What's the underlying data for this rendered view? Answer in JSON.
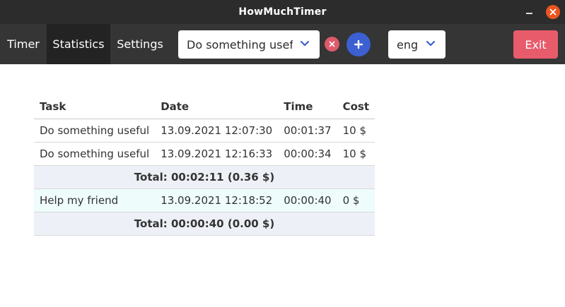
{
  "window": {
    "title": "HowMuchTimer"
  },
  "nav": {
    "timer": "Timer",
    "statistics": "Statistics",
    "settings": "Settings"
  },
  "task_select": {
    "value": "Do something useful"
  },
  "lang_select": {
    "value": "eng"
  },
  "exit_label": "Exit",
  "colors": {
    "accent_blue": "#3c5fd1",
    "exit_red": "#e85b6b",
    "close_orange": "#e95420",
    "clear_red": "#de5a6b"
  },
  "table": {
    "headers": {
      "task": "Task",
      "date": "Date",
      "time": "Time",
      "cost": "Cost"
    },
    "rows": [
      {
        "task": "Do something useful",
        "date": "13.09.2021 12:07:30",
        "time": "00:01:37",
        "cost": "10 $"
      },
      {
        "task": "Do something useful",
        "date": "13.09.2021 12:16:33",
        "time": "00:00:34",
        "cost": "10 $"
      },
      {
        "total": "Total: 00:02:11 (0.36 $)"
      },
      {
        "task": "Help my friend",
        "date": "13.09.2021 12:18:52",
        "time": "00:00:40",
        "cost": "0 $"
      },
      {
        "total": "Total: 00:00:40 (0.00 $)"
      }
    ]
  }
}
